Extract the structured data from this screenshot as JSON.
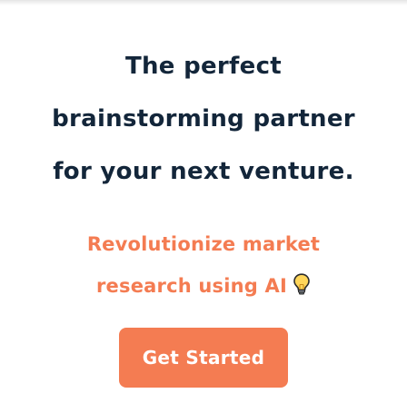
{
  "hero": {
    "headline_lines": [
      "The perfect",
      "brainstorming partner",
      "for your next venture."
    ],
    "subheadline_lines": [
      "Revolutionize market",
      "research using AI"
    ],
    "subheadline_icon": "lightbulb-icon"
  },
  "cta": {
    "label": "Get Started"
  },
  "colors": {
    "heading": "#13263a",
    "accent": "#f47c52",
    "background": "#ffffff",
    "button_text": "#ffffff"
  }
}
